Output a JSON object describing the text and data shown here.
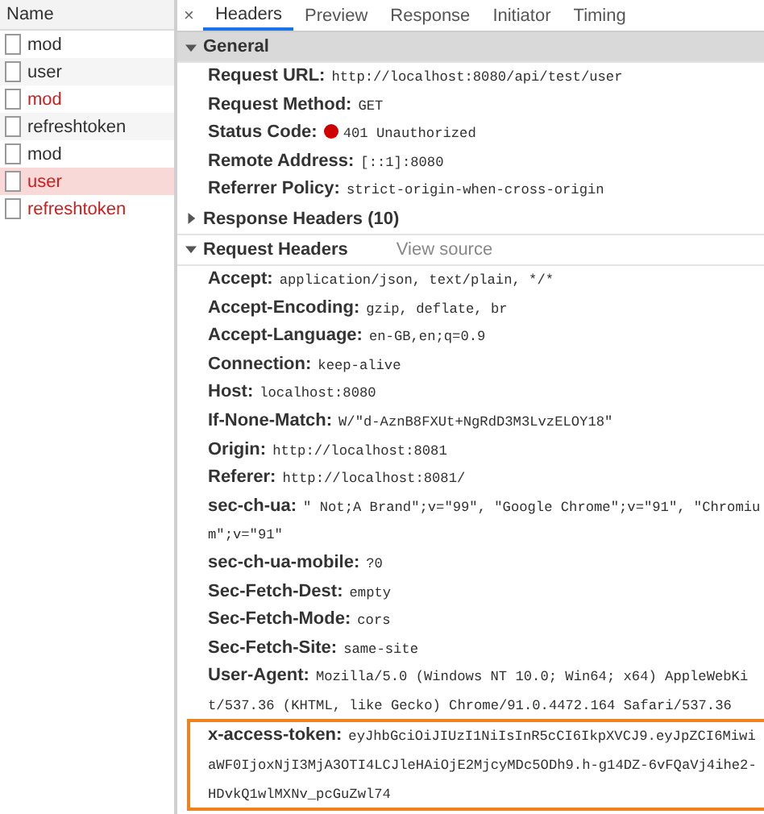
{
  "name_column": {
    "heading": "Name",
    "requests": [
      {
        "name": "mod",
        "failed": false,
        "selected": false
      },
      {
        "name": "user",
        "failed": false,
        "selected": false
      },
      {
        "name": "mod",
        "failed": true,
        "selected": false
      },
      {
        "name": "refreshtoken",
        "failed": false,
        "selected": false
      },
      {
        "name": "mod",
        "failed": false,
        "selected": false
      },
      {
        "name": "user",
        "failed": true,
        "selected": true
      },
      {
        "name": "refreshtoken",
        "failed": true,
        "selected": false
      }
    ]
  },
  "close_symbol": "×",
  "tabs": [
    {
      "label": "Headers",
      "selected": true
    },
    {
      "label": "Preview",
      "selected": false
    },
    {
      "label": "Response",
      "selected": false
    },
    {
      "label": "Initiator",
      "selected": false
    },
    {
      "label": "Timing",
      "selected": false
    }
  ],
  "sections": [
    {
      "title": "General",
      "expanded": true,
      "shaded": true,
      "rows": [
        {
          "key": "Request URL:",
          "value": "http://localhost:8080/api/test/user",
          "kind": "plain",
          "highlighted": false
        },
        {
          "key": "Request Method:",
          "value": "GET",
          "kind": "plain",
          "highlighted": false
        },
        {
          "key": "Status Code:",
          "value": "401 Unauthorized",
          "kind": "status",
          "highlighted": false
        },
        {
          "key": "Remote Address:",
          "value": "[::1]:8080",
          "kind": "plain",
          "highlighted": false
        },
        {
          "key": "Referrer Policy:",
          "value": "strict-origin-when-cross-origin",
          "kind": "plain",
          "highlighted": false
        }
      ]
    },
    {
      "title": "Response Headers (10)",
      "expanded": false,
      "shaded": false
    },
    {
      "title": "Request Headers",
      "link": "View source",
      "expanded": true,
      "shaded": false,
      "rows": [
        {
          "key": "Accept:",
          "value": "application/json, text/plain, */*",
          "kind": "plain",
          "highlighted": false
        },
        {
          "key": "Accept-Encoding:",
          "value": "gzip, deflate, br",
          "kind": "plain",
          "highlighted": false
        },
        {
          "key": "Accept-Language:",
          "value": "en-GB,en;q=0.9",
          "kind": "plain",
          "highlighted": false
        },
        {
          "key": "Connection:",
          "value": "keep-alive",
          "kind": "plain",
          "highlighted": false
        },
        {
          "key": "Host:",
          "value": "localhost:8080",
          "kind": "plain",
          "highlighted": false
        },
        {
          "key": "If-None-Match:",
          "value": "W/\"d-AznB8FXUt+NgRdD3M3LvzELOY18\"",
          "kind": "plain",
          "highlighted": false
        },
        {
          "key": "Origin:",
          "value": "http://localhost:8081",
          "kind": "plain",
          "highlighted": false
        },
        {
          "key": "Referer:",
          "value": "http://localhost:8081/",
          "kind": "plain",
          "highlighted": false
        },
        {
          "key": "sec-ch-ua:",
          "value": "\" Not;A Brand\";v=\"99\", \"Google Chrome\";v=\"91\", \"Chromium\";v=\"91\"",
          "kind": "plain",
          "highlighted": false
        },
        {
          "key": "sec-ch-ua-mobile:",
          "value": "?0",
          "kind": "plain",
          "highlighted": false
        },
        {
          "key": "Sec-Fetch-Dest:",
          "value": "empty",
          "kind": "plain",
          "highlighted": false
        },
        {
          "key": "Sec-Fetch-Mode:",
          "value": "cors",
          "kind": "plain",
          "highlighted": false
        },
        {
          "key": "Sec-Fetch-Site:",
          "value": "same-site",
          "kind": "plain",
          "highlighted": false
        },
        {
          "key": "User-Agent:",
          "value": "Mozilla/5.0 (Windows NT 10.0; Win64; x64) AppleWebKit/537.36 (KHTML, like Gecko) Chrome/91.0.4472.164 Safari/537.36",
          "kind": "plain",
          "highlighted": false
        },
        {
          "key": "x-access-token:",
          "value": "eyJhbGciOiJIUzI1NiIsInR5cCI6IkpXVCJ9.eyJpZCI6MiwiaWF0IjoxNjI3MjA3OTI4LCJleHAiOjE2MjcyMDc5ODh9.h-g14DZ-6vFQaVj4ihe2-HDvkQ1wlMXNv_pcGuZwl74",
          "kind": "plain",
          "highlighted": true
        }
      ]
    }
  ]
}
